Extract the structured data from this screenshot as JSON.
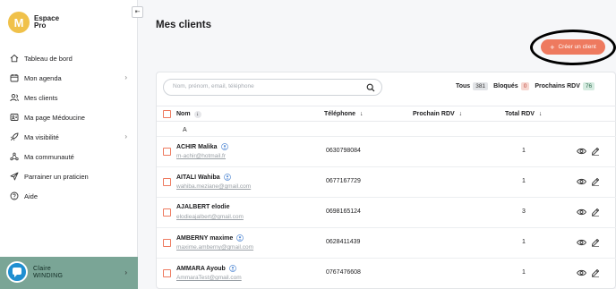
{
  "brand": {
    "mark": "M",
    "line1": "Espace",
    "line2": "Pro"
  },
  "sidebar": {
    "collapse": "⇤",
    "items": [
      {
        "label": "Tableau de bord",
        "icon": "home-icon",
        "chevron": false
      },
      {
        "label": "Mon agenda",
        "icon": "calendar-icon",
        "chevron": true
      },
      {
        "label": "Mes clients",
        "icon": "users-icon",
        "chevron": false
      },
      {
        "label": "Ma page Médoucine",
        "icon": "page-icon",
        "chevron": false
      },
      {
        "label": "Ma visibilité",
        "icon": "rocket-icon",
        "chevron": true
      },
      {
        "label": "Ma communauté",
        "icon": "network-icon",
        "chevron": false
      },
      {
        "label": "Parrainer un praticien",
        "icon": "send-icon",
        "chevron": false
      },
      {
        "label": "Aide",
        "icon": "help-icon",
        "chevron": false
      }
    ],
    "user": {
      "first": "Claire",
      "last": "WINDING"
    }
  },
  "main": {
    "title": "Mes clients",
    "create_button": "Créer un client",
    "search": {
      "placeholder": "Nom, prénom, email, téléphone",
      "value": ""
    },
    "filters": [
      {
        "label": "Tous",
        "count": "381",
        "style": "grey"
      },
      {
        "label": "Bloqués",
        "count": "0",
        "style": "red"
      },
      {
        "label": "Prochains RDV",
        "count": "76",
        "style": "green"
      }
    ],
    "columns": {
      "name": "Nom",
      "phone": "Téléphone",
      "next_rdv": "Prochain RDV",
      "total_rdv": "Total RDV"
    },
    "sort_arrow": "↓",
    "group_letter": "A",
    "rows": [
      {
        "name": "ACHIR Malika",
        "email": "m-achir@hotmail.fr",
        "phone": "0630798084",
        "next_rdv": "",
        "total_rdv": "1"
      },
      {
        "name": "AITALI Wahiba",
        "email": "wahiba.meziane@gmail.com",
        "phone": "0677167729",
        "next_rdv": "",
        "total_rdv": "1"
      },
      {
        "name": "AJALBERT elodie",
        "email": "elodieajalbert@gmail.com",
        "phone": "0698165124",
        "next_rdv": "",
        "total_rdv": "3"
      },
      {
        "name": "AMBERNY maxime",
        "email": "maxime.amberny@gmail.com",
        "phone": "0628411439",
        "next_rdv": "",
        "total_rdv": "1"
      },
      {
        "name": "AMMARA Ayoub",
        "email": "AmmaraTest@gmail.com",
        "phone": "0767476608",
        "next_rdv": "",
        "total_rdv": "1"
      }
    ]
  },
  "colors": {
    "accent": "#ee7a5f",
    "brand": "#f0c14a",
    "user_bg": "#7aa596"
  }
}
